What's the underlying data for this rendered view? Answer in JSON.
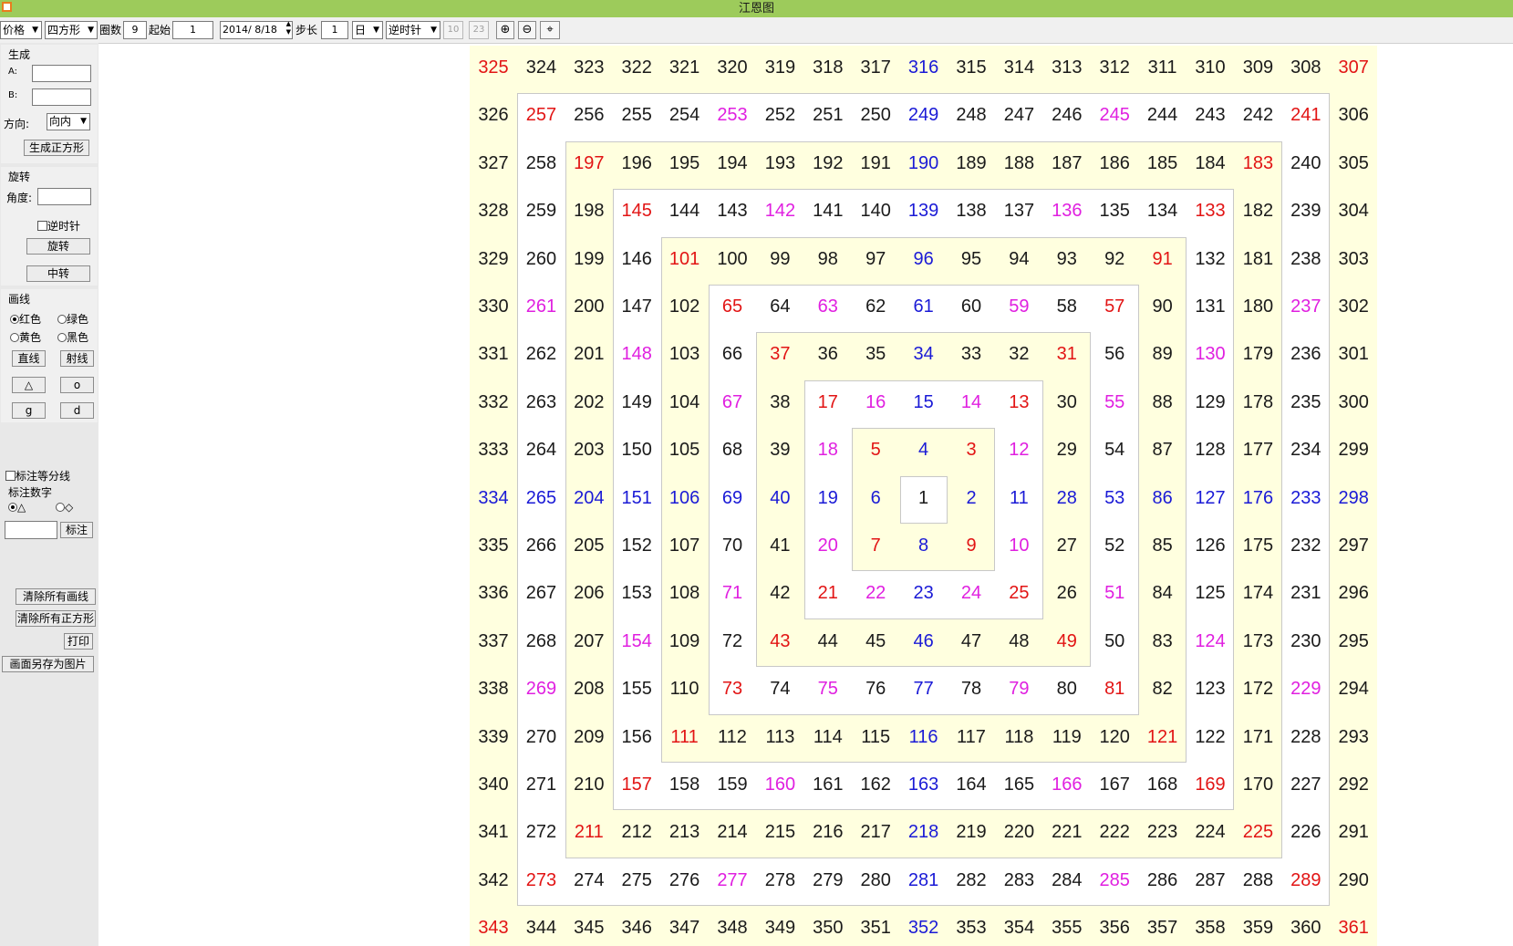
{
  "window": {
    "title": "江恩图"
  },
  "toolbar": {
    "price_select": "价格",
    "shape_select": "四方形",
    "rings_label": "圈数",
    "rings_value": "9",
    "start_label": "起始",
    "start_value": "1",
    "date_value": "2014/ 8/18",
    "step_label": "步长",
    "step_value": "1",
    "period_select": "日",
    "direction_select": "逆时针",
    "disabled_a": "10",
    "disabled_b": "23"
  },
  "icons": {
    "zoom_in": "zoom-in-icon",
    "zoom_out": "zoom-out-icon",
    "center": "crosshair-icon"
  },
  "panel": {
    "generate": {
      "title": "生成",
      "a_label": "A:",
      "b_label": "B:",
      "direction_label": "方向:",
      "direction_value": "向内",
      "button": "生成正方形"
    },
    "rotate": {
      "title": "旋转",
      "angle_label": "角度:",
      "ccw_label": "逆时针",
      "rotate_button": "旋转",
      "center_button": "中转"
    },
    "draw": {
      "title": "画线",
      "red": "红色",
      "green": "绿色",
      "yellow": "黄色",
      "black": "黑色",
      "line_button": "直线",
      "ray_button": "射线",
      "triangle_button": "△",
      "circle_button": "o",
      "g_button": "g",
      "d_button": "d"
    },
    "mark": {
      "divider_label": "标注等分线",
      "numbers_title": "标注数字",
      "triangle_opt": "△",
      "diamond_opt": "◇",
      "mark_button": "标注"
    },
    "clear_lines": "清除所有画线",
    "clear_squares": "清除所有正方形",
    "print": "打印",
    "save_image": "画面另存为图片"
  },
  "colors": {
    "red": "#e21414",
    "blue": "#1a1ad6",
    "magenta": "#e020e0",
    "black": "#1a1a1a",
    "cream": "#ffffdf",
    "white": "#ffffff"
  },
  "grid": {
    "columns": 19,
    "rows": [
      [
        "325r",
        "324",
        "323",
        "322",
        "321",
        "320",
        "319",
        "318",
        "317",
        "316b",
        "315",
        "314",
        "313",
        "312",
        "311",
        "310",
        "309",
        "308",
        "307r"
      ],
      [
        "326",
        "257r",
        "256",
        "255",
        "254",
        "253m",
        "252",
        "251",
        "250",
        "249b",
        "248",
        "247",
        "246",
        "245m",
        "244",
        "243",
        "242",
        "241r",
        "306"
      ],
      [
        "327",
        "258",
        "197r",
        "196",
        "195",
        "194",
        "193",
        "192",
        "191",
        "190b",
        "189",
        "188",
        "187",
        "186",
        "185",
        "184",
        "183r",
        "240",
        "305"
      ],
      [
        "328",
        "259",
        "198",
        "145r",
        "144",
        "143",
        "142m",
        "141",
        "140",
        "139b",
        "138",
        "137",
        "136m",
        "135",
        "134",
        "133r",
        "182",
        "239",
        "304"
      ],
      [
        "329",
        "260",
        "199",
        "146",
        "101r",
        "100",
        "99",
        "98",
        "97",
        "96b",
        "95",
        "94",
        "93",
        "92",
        "91r",
        "132",
        "181",
        "238",
        "303"
      ],
      [
        "330",
        "261m",
        "200",
        "147",
        "102",
        "65r",
        "64",
        "63m",
        "62",
        "61b",
        "60",
        "59m",
        "58",
        "57r",
        "90",
        "131",
        "180",
        "237m",
        "302"
      ],
      [
        "331",
        "262",
        "201",
        "148m",
        "103",
        "66",
        "37r",
        "36",
        "35",
        "34b",
        "33",
        "32",
        "31r",
        "56",
        "89",
        "130m",
        "179",
        "236",
        "301"
      ],
      [
        "332",
        "263",
        "202",
        "149",
        "104",
        "67m",
        "38",
        "17r",
        "16m",
        "15b",
        "14m",
        "13r",
        "30",
        "55m",
        "88",
        "129",
        "178",
        "235",
        "300"
      ],
      [
        "333",
        "264",
        "203",
        "150",
        "105",
        "68",
        "39",
        "18m",
        "5r",
        "4b",
        "3r",
        "12m",
        "29",
        "54",
        "87",
        "128",
        "177",
        "234",
        "299"
      ],
      [
        "334b",
        "265b",
        "204b",
        "151b",
        "106b",
        "69b",
        "40b",
        "19b",
        "6b",
        "1",
        "2b",
        "11b",
        "28b",
        "53b",
        "86b",
        "127b",
        "176b",
        "233b",
        "298b"
      ],
      [
        "335",
        "266",
        "205",
        "152",
        "107",
        "70",
        "41",
        "20m",
        "7r",
        "8b",
        "9r",
        "10m",
        "27",
        "52",
        "85",
        "126",
        "175",
        "232",
        "297"
      ],
      [
        "336",
        "267",
        "206",
        "153",
        "108",
        "71m",
        "42",
        "21r",
        "22m",
        "23b",
        "24m",
        "25r",
        "26",
        "51m",
        "84",
        "125",
        "174",
        "231",
        "296"
      ],
      [
        "337",
        "268",
        "207",
        "154m",
        "109",
        "72",
        "43r",
        "44",
        "45",
        "46b",
        "47",
        "48",
        "49r",
        "50",
        "83",
        "124m",
        "173",
        "230",
        "295"
      ],
      [
        "338",
        "269m",
        "208",
        "155",
        "110",
        "73r",
        "74",
        "75m",
        "76",
        "77b",
        "78",
        "79m",
        "80",
        "81r",
        "82",
        "123",
        "172",
        "229m",
        "294"
      ],
      [
        "339",
        "270",
        "209",
        "156",
        "111r",
        "112",
        "113",
        "114",
        "115",
        "116b",
        "117",
        "118",
        "119",
        "120",
        "121r",
        "122",
        "171",
        "228",
        "293"
      ],
      [
        "340",
        "271",
        "210",
        "157r",
        "158",
        "159",
        "160m",
        "161",
        "162",
        "163b",
        "164",
        "165",
        "166m",
        "167",
        "168",
        "169r",
        "170",
        "227",
        "292"
      ],
      [
        "341",
        "272",
        "211r",
        "212",
        "213",
        "214",
        "215",
        "216",
        "217",
        "218b",
        "219",
        "220",
        "221",
        "222",
        "223",
        "224",
        "225r",
        "226",
        "291"
      ],
      [
        "342",
        "273r",
        "274",
        "275",
        "276",
        "277m",
        "278",
        "279",
        "280",
        "281b",
        "282",
        "283",
        "284",
        "285m",
        "286",
        "287",
        "288",
        "289r",
        "290"
      ],
      [
        "343r",
        "344",
        "345",
        "346",
        "347",
        "348",
        "349",
        "350",
        "351",
        "352b",
        "353",
        "354",
        "355",
        "356",
        "357",
        "358",
        "359",
        "360",
        "361r"
      ]
    ]
  }
}
